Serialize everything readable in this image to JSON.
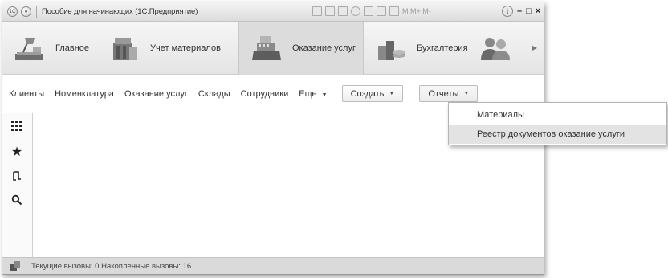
{
  "titlebar": {
    "app_icon": "1c-logo-icon",
    "menu_icon": "main-menu-icon",
    "title": "Пособие для начинающих  (1С:Предприятие)",
    "tools_text": "M  M+  M-",
    "info_icon": "info-icon",
    "controls": {
      "minimize": "–",
      "maximize": "□",
      "close": "×"
    }
  },
  "sections": [
    {
      "label": "Главное",
      "icon": "desk-lamp-icon"
    },
    {
      "label": "Учет материалов",
      "icon": "materials-icon"
    },
    {
      "label": "Оказание услуг",
      "icon": "cash-register-icon",
      "active": true
    },
    {
      "label": "Бухгалтерия",
      "icon": "coins-icon"
    },
    {
      "label": "",
      "icon": "people-icon"
    }
  ],
  "command_bar": {
    "links": [
      "Клиенты",
      "Номенклатура",
      "Оказание услуг",
      "Склады",
      "Сотрудники",
      "Еще"
    ],
    "create_label": "Создать",
    "reports_label": "Отчеты"
  },
  "left_tools": [
    "grid-menu-icon",
    "star-icon",
    "history-icon",
    "search-icon"
  ],
  "menu": {
    "items": [
      "Материалы",
      "Реестр документов оказание услуги"
    ],
    "highlighted_index": 1
  },
  "statusbar": {
    "icon": "calls-icon",
    "text": "Текущие вызовы: 0   Накопленные вызовы: 16"
  }
}
